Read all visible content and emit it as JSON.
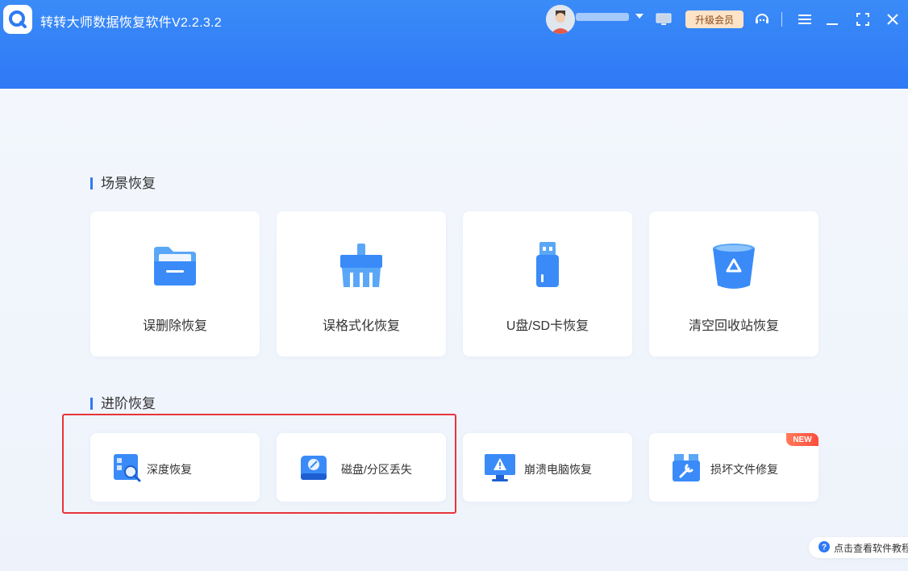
{
  "app": {
    "title": "转转大师数据恢复软件V2.2.3.2",
    "vip_label": "升级会员"
  },
  "colors": {
    "header_blue": "#2f79f5",
    "highlight_red": "#e8343a",
    "vip_bg": "#fde3c8"
  },
  "sections": {
    "scene_title": "场景恢复",
    "advanced_title": "进阶恢复"
  },
  "scene_cards": [
    {
      "label": "误删除恢复",
      "icon": "folder-icon"
    },
    {
      "label": "误格式化恢复",
      "icon": "brush-icon"
    },
    {
      "label": "U盘/SD卡恢复",
      "icon": "usb-drive-icon"
    },
    {
      "label": "清空回收站恢复",
      "icon": "recycle-bin-icon"
    }
  ],
  "advanced_cards": [
    {
      "label": "深度恢复",
      "icon": "deep-scan-icon"
    },
    {
      "label": "磁盘/分区丢失",
      "icon": "disk-icon"
    },
    {
      "label": "崩溃电脑恢复",
      "icon": "crashed-monitor-icon"
    },
    {
      "label": "损坏文件修复",
      "icon": "file-repair-icon",
      "badge": "NEW"
    }
  ],
  "help": {
    "label": "点击查看软件教程"
  }
}
